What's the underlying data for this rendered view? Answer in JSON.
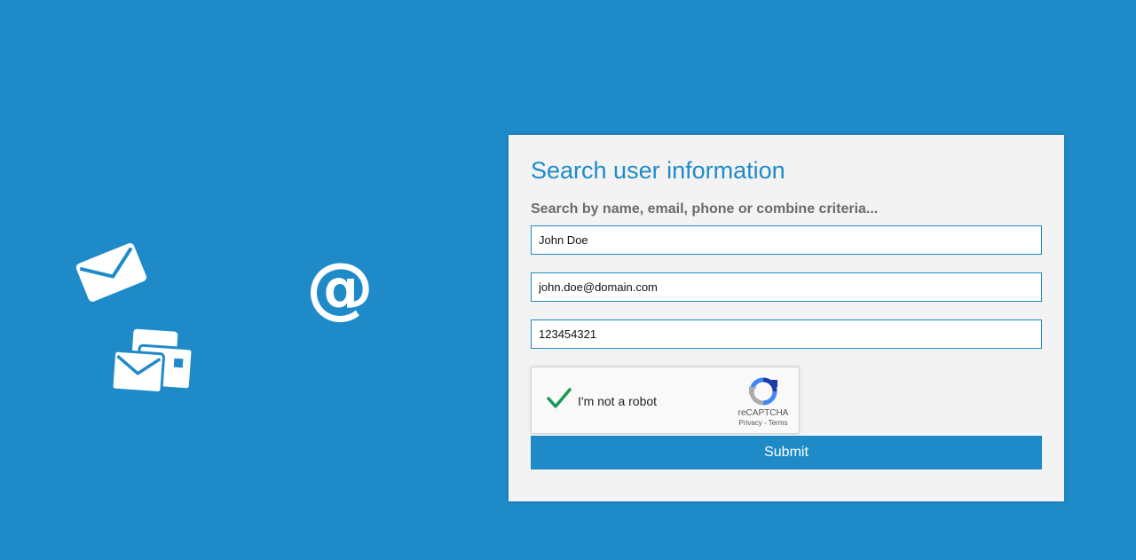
{
  "colors": {
    "background": "#1e8bc8",
    "panel": "#f3f3f3",
    "accent": "#1e8bc8",
    "check": "#1a9954"
  },
  "decorations": [
    "envelope-icon",
    "at-sign-icon",
    "cards-envelope-icon"
  ],
  "form": {
    "title": "Search user information",
    "subtitle": "Search by name, email, phone or combine criteria...",
    "name_value": "John Doe",
    "email_value": "john.doe@domain.com",
    "phone_value": "123454321",
    "submit_label": "Submit"
  },
  "captcha": {
    "label": "I'm not a robot",
    "checked": true,
    "brand": "reCAPTCHA",
    "privacy_link": "Privacy",
    "separator": "-",
    "terms_link": "Terms"
  }
}
